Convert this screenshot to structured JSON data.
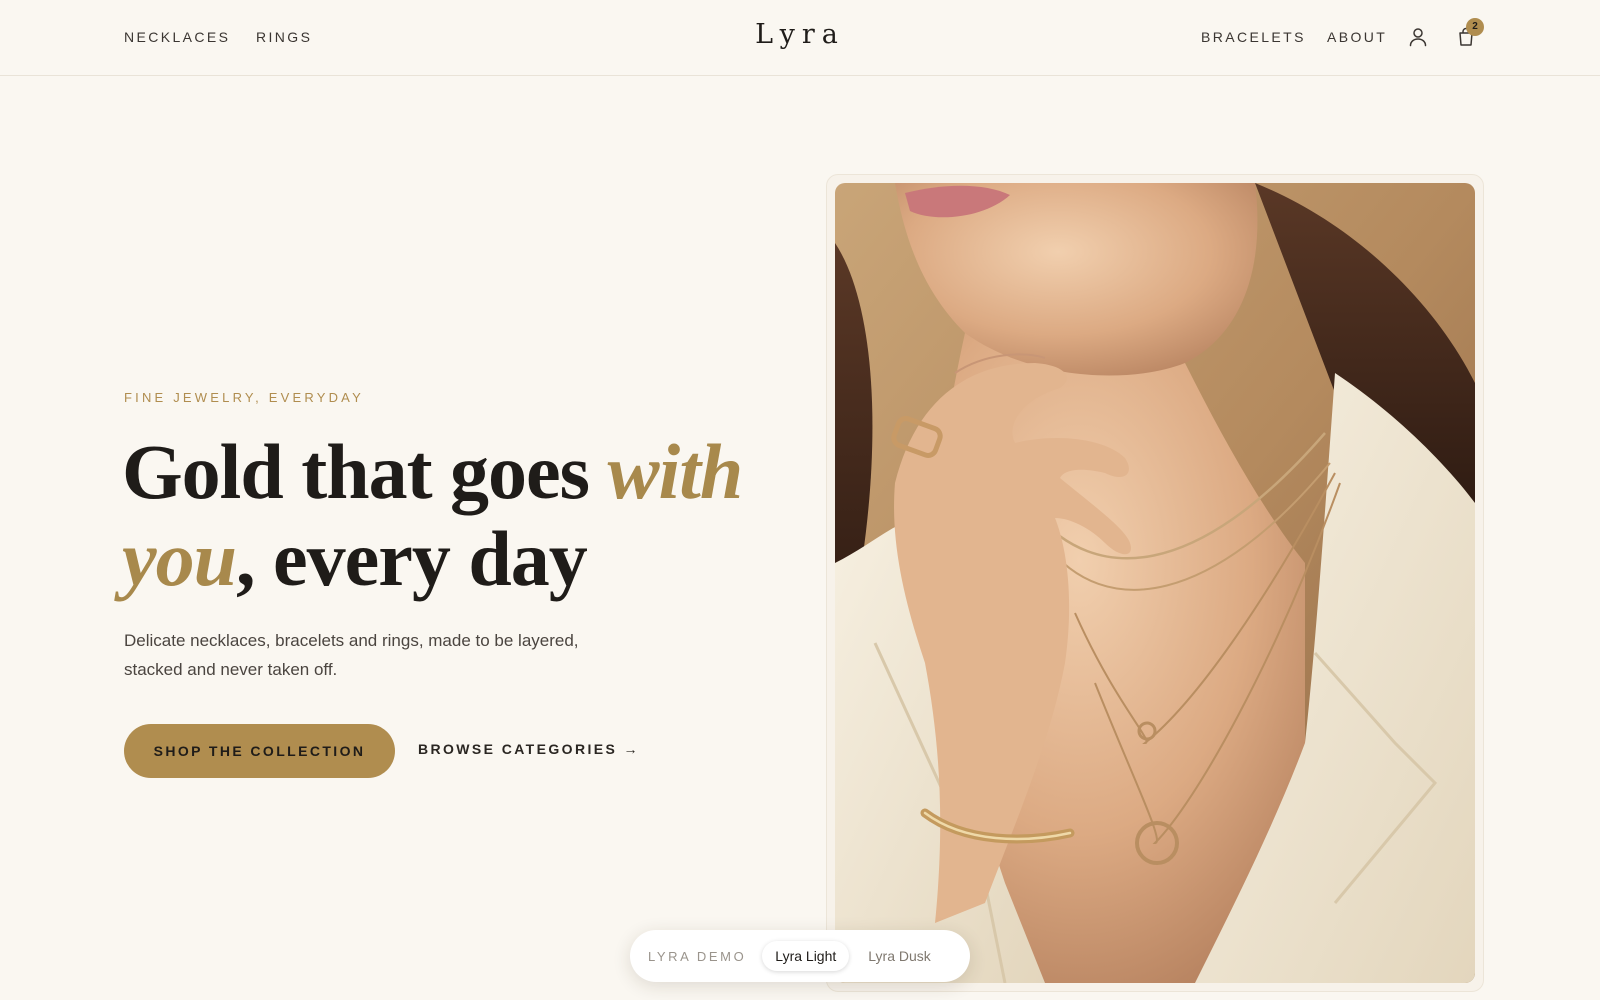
{
  "header": {
    "nav_left": [
      "NECKLACES",
      "RINGS"
    ],
    "logo": "Lyra",
    "nav_right": [
      "BRACELETS",
      "ABOUT"
    ],
    "cart_count": "2",
    "icons": [
      "account-icon",
      "cart-icon"
    ]
  },
  "hero": {
    "eyebrow": "FINE JEWELRY, EVERYDAY",
    "headline_part1": "Gold that goes ",
    "headline_accent": "with you",
    "headline_part2": ", every day",
    "subcopy": "Delicate necklaces, bracelets and rings, made to be layered, stacked and never taken off.",
    "primary_cta": "SHOP THE COLLECTION",
    "secondary_cta": "BROWSE CATEGORIES →"
  },
  "demo_switcher": {
    "label": "LYRA DEMO",
    "options": [
      "Lyra Light",
      "Lyra Dusk"
    ],
    "selected": "Lyra Light"
  },
  "colors": {
    "background": "#faf7f1",
    "accent_gold": "#b08d4f",
    "text_dark": "#1f1c19"
  }
}
